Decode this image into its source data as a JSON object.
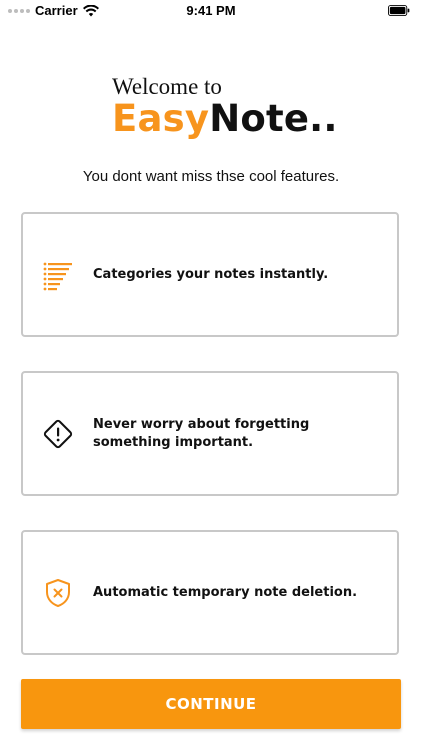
{
  "status_bar": {
    "carrier": "Carrier",
    "time": "9:41 PM"
  },
  "header": {
    "welcome": "Welcome to",
    "brand_part1": "Easy",
    "brand_part2": "Note.."
  },
  "subtitle": "You dont want miss thse cool features.",
  "features": [
    {
      "icon": "list-icon",
      "text": "Categories your notes instantly."
    },
    {
      "icon": "warning-icon",
      "text": "Never worry about  forgetting\nsomething  important."
    },
    {
      "icon": "shield-x-icon",
      "text": "Automatic temporary note deletion."
    }
  ],
  "continue_label": "CONTINUE",
  "colors": {
    "accent": "#f7941d",
    "button": "#f8960e",
    "card_border": "#c8c8c8"
  }
}
